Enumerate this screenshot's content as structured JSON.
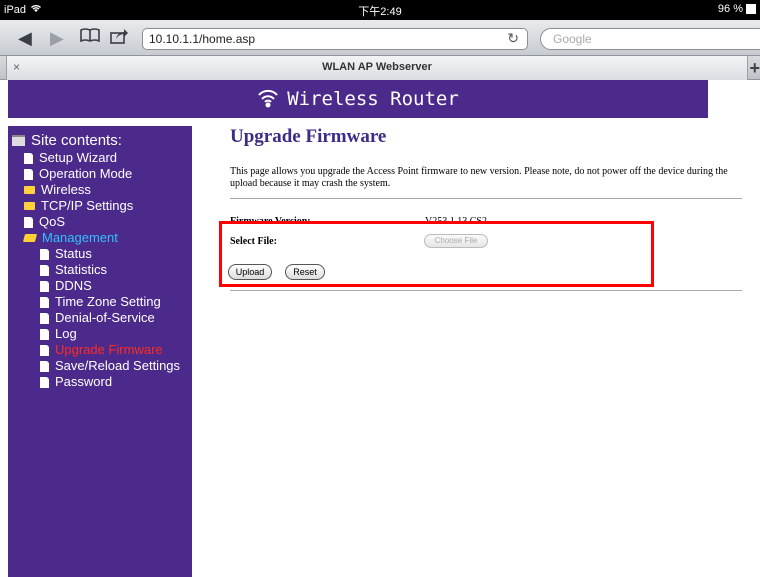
{
  "statusbar": {
    "device": "iPad",
    "time": "下午2:49",
    "battery": "96 %"
  },
  "browser": {
    "url": "10.10.1.1/home.asp",
    "search_placeholder": "Google",
    "tab_title": "WLAN AP Webserver",
    "tab_close": "×",
    "tab_add": "+"
  },
  "banner": {
    "title": "Wireless Router"
  },
  "sidebar": {
    "title": "Site contents:",
    "items": [
      {
        "label": "Setup Wizard"
      },
      {
        "label": "Operation Mode"
      },
      {
        "label": "Wireless"
      },
      {
        "label": "TCP/IP Settings"
      },
      {
        "label": "QoS"
      },
      {
        "label": "Management"
      },
      {
        "label": "Status"
      },
      {
        "label": "Statistics"
      },
      {
        "label": "DDNS"
      },
      {
        "label": "Time Zone Setting"
      },
      {
        "label": "Denial-of-Service"
      },
      {
        "label": "Log"
      },
      {
        "label": "Upgrade Firmware"
      },
      {
        "label": "Save/Reload Settings"
      },
      {
        "label": "Password"
      }
    ]
  },
  "main": {
    "title": "Upgrade Firmware",
    "description": "This page allows you upgrade the Access Point firmware to new version. Please note, do not power off the device during the upload because it may crash the system.",
    "firmware_label": "Firmware Version:",
    "firmware_value": "V253.1.13.CS2",
    "select_file_label": "Select File:",
    "choose_file_label": "Choose File",
    "upload_label": "Upload",
    "reset_label": "Reset"
  },
  "colors": {
    "accent": "#4b2a8c",
    "title": "#3c2b89",
    "current_item": "#ff2a1f",
    "active_item": "#33bfff",
    "highlight": "#ff0000"
  }
}
